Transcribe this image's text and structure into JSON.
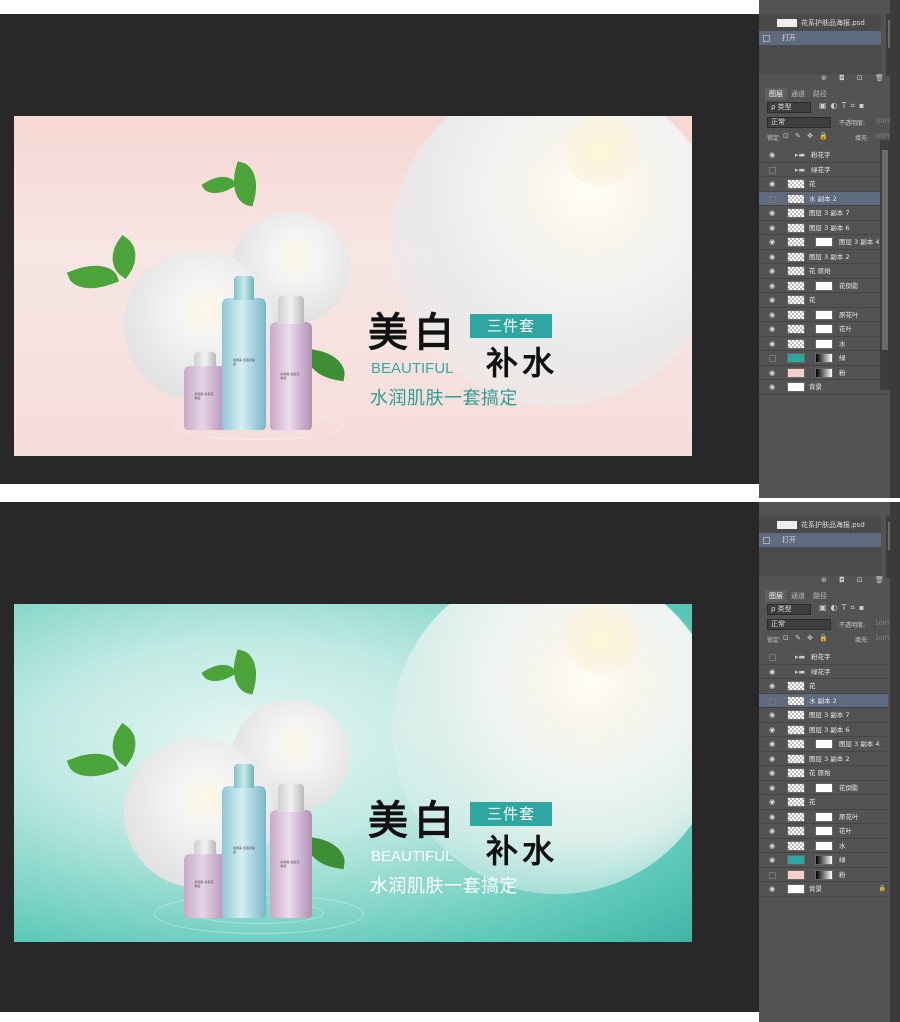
{
  "document": {
    "file_name": "花系护肤品海报.psd",
    "action_open": "打开"
  },
  "panel": {
    "tabs": [
      "图层",
      "通道",
      "路径"
    ],
    "filter_label": "ρ 类型",
    "blend_mode": "正常",
    "opacity_label": "不透明度:",
    "opacity_value": "100%",
    "lock_label": "锁定:",
    "fill_label": "填充:",
    "fill_value": "100%",
    "mini_icons": "⊕ ◘ ⊡ 🗑",
    "more_icon": "»"
  },
  "layers": [
    {
      "name": "粉花字",
      "type": "group"
    },
    {
      "name": "绿花字",
      "type": "group"
    },
    {
      "name": "花",
      "type": "pixel"
    },
    {
      "name": "水 副本 2",
      "type": "pixel",
      "active": true
    },
    {
      "name": "图层 3 副本 7",
      "type": "pixel"
    },
    {
      "name": "图层 3 副本 6",
      "type": "pixel"
    },
    {
      "name": "图层 3 副本 4",
      "type": "masked"
    },
    {
      "name": "图层 3 副本 2",
      "type": "pixel"
    },
    {
      "name": "花 原始",
      "type": "pixel"
    },
    {
      "name": "花倒影",
      "type": "masked"
    },
    {
      "name": "花",
      "type": "pixel"
    },
    {
      "name": "原花叶",
      "type": "masked"
    },
    {
      "name": "花叶",
      "type": "masked"
    },
    {
      "name": "水",
      "type": "masked"
    },
    {
      "name": "绿",
      "type": "color",
      "color": "#2ea7a0"
    },
    {
      "name": "粉",
      "type": "color",
      "color": "#f5cfc8"
    },
    {
      "name": "背景",
      "type": "background"
    }
  ],
  "poster": {
    "title_main": "美白",
    "title_second": "补水",
    "tag": "三件套",
    "english": "BEAUTIFUL",
    "subtitle": "水润肌肤一套搞定",
    "bottle_label": "植物美 金银花精露"
  },
  "colors": {
    "workspace": "#282828",
    "panel": "#535353",
    "accent_teal": "#2ea7a0",
    "pink_bg": "#f6d7d3"
  }
}
